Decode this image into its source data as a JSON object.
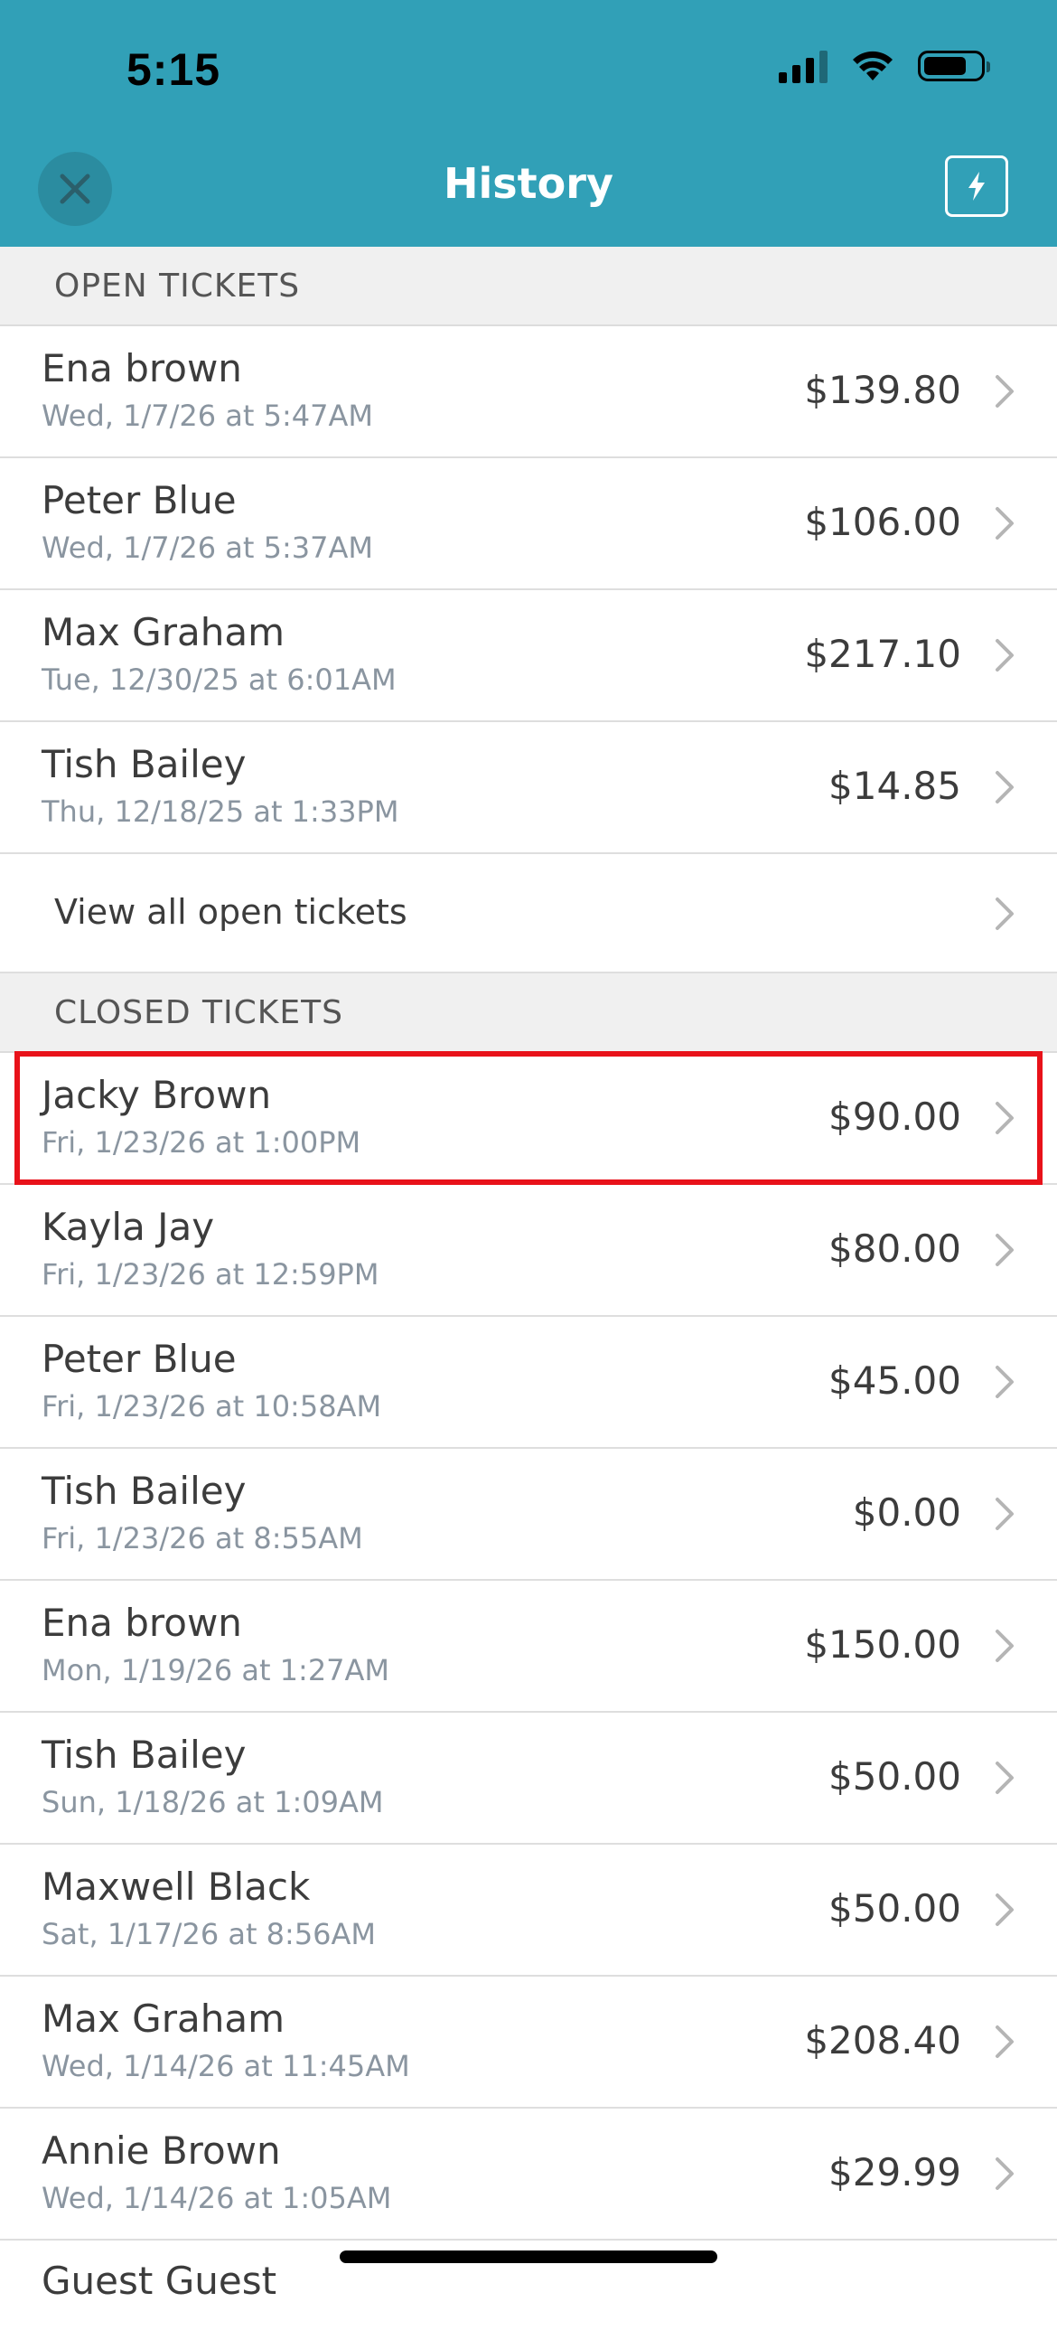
{
  "status_bar": {
    "time": "5:15"
  },
  "header": {
    "title": "History",
    "background_color": "#31a0b7"
  },
  "open_tickets": {
    "section_label": "OPEN TICKETS",
    "items": [
      {
        "name": "Ena brown",
        "date": "Wed, 1/7/26 at 5:47AM",
        "amount": "$139.80"
      },
      {
        "name": "Peter Blue",
        "date": "Wed, 1/7/26 at 5:37AM",
        "amount": "$106.00"
      },
      {
        "name": "Max Graham",
        "date": "Tue, 12/30/25 at 6:01AM",
        "amount": "$217.10"
      },
      {
        "name": "Tish Bailey",
        "date": "Thu, 12/18/25 at 1:33PM",
        "amount": "$14.85"
      }
    ],
    "view_all_label": "View all open tickets"
  },
  "closed_tickets": {
    "section_label": "CLOSED TICKETS",
    "items": [
      {
        "name": "Jacky Brown",
        "date": "Fri, 1/23/26 at 1:00PM",
        "amount": "$90.00"
      },
      {
        "name": "Kayla Jay",
        "date": "Fri, 1/23/26 at 12:59PM",
        "amount": "$80.00"
      },
      {
        "name": "Peter Blue",
        "date": "Fri, 1/23/26 at 10:58AM",
        "amount": "$45.00"
      },
      {
        "name": "Tish Bailey",
        "date": "Fri, 1/23/26 at 8:55AM",
        "amount": "$0.00"
      },
      {
        "name": "Ena brown",
        "date": "Mon, 1/19/26 at 1:27AM",
        "amount": "$150.00"
      },
      {
        "name": "Tish Bailey",
        "date": "Sun, 1/18/26 at 1:09AM",
        "amount": "$50.00"
      },
      {
        "name": "Maxwell Black",
        "date": "Sat, 1/17/26 at 8:56AM",
        "amount": "$50.00"
      },
      {
        "name": "Max Graham",
        "date": "Wed, 1/14/26 at 11:45AM",
        "amount": "$208.40"
      },
      {
        "name": "Annie Brown",
        "date": "Wed, 1/14/26 at 1:05AM",
        "amount": "$29.99"
      }
    ],
    "partial_item_name": "Guest Guest"
  },
  "colors": {
    "highlight_border": "#e8121a"
  }
}
